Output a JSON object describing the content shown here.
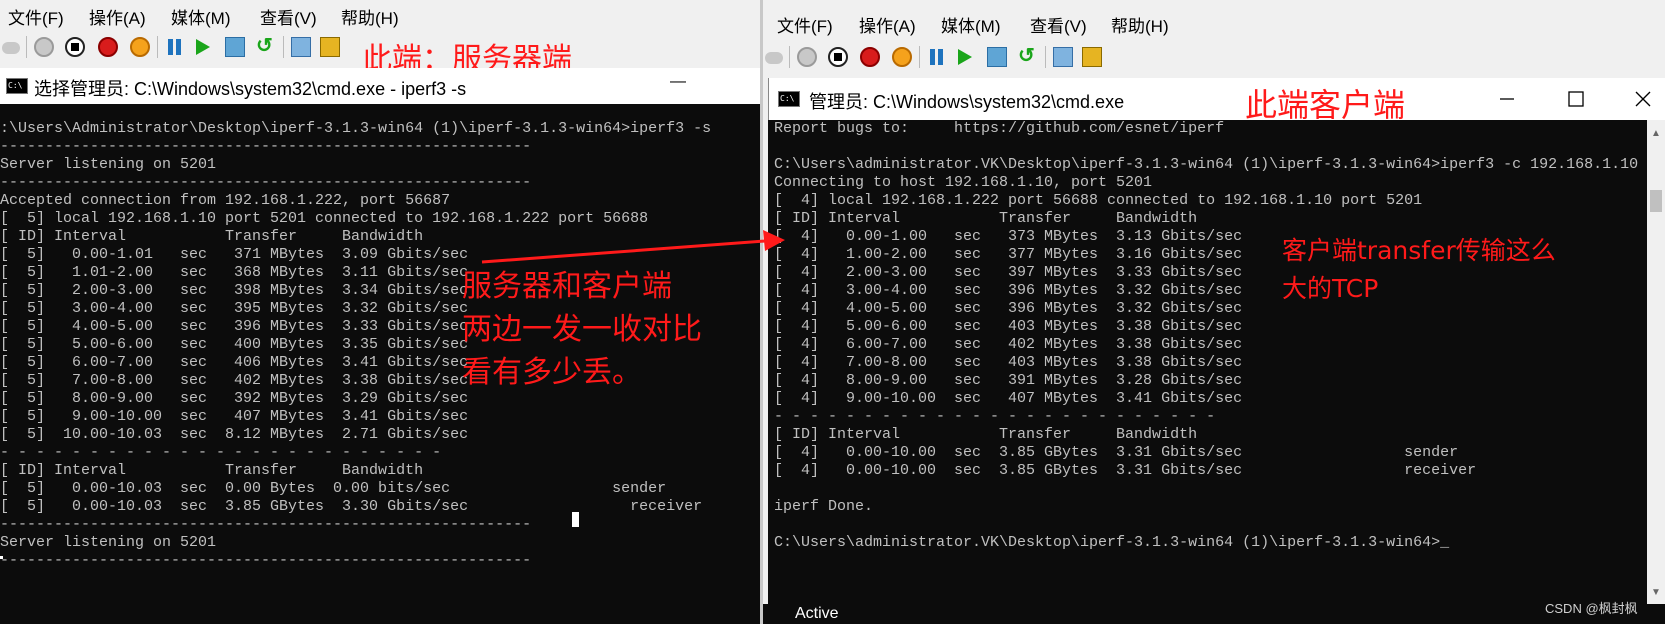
{
  "left": {
    "menu": [
      "文件(F)",
      "操作(A)",
      "媒体(M)",
      "查看(V)",
      "帮助(H)"
    ],
    "window_title": "选择管理员: C:\\Windows\\system32\\cmd.exe - iperf3  -s",
    "minimize_glyph": "—",
    "annotation_role": "此端：服务器端",
    "annotation_compare": [
      "服务器和客户端",
      "两边一发一收对比",
      "看有多少丢。"
    ],
    "console_lines": [
      ":\\Users\\Administrator\\Desktop\\iperf-3.1.3-win64 (1)\\iperf-3.1.3-win64>iperf3 -s",
      "-----------------------------------------------------------",
      "Server listening on 5201",
      "-----------------------------------------------------------",
      "Accepted connection from 192.168.1.222, port 56687",
      "[  5] local 192.168.1.10 port 5201 connected to 192.168.1.222 port 56688",
      "[ ID] Interval           Transfer     Bandwidth",
      "[  5]   0.00-1.01   sec   371 MBytes  3.09 Gbits/sec",
      "[  5]   1.01-2.00   sec   368 MBytes  3.11 Gbits/sec",
      "[  5]   2.00-3.00   sec   398 MBytes  3.34 Gbits/sec",
      "[  5]   3.00-4.00   sec   395 MBytes  3.32 Gbits/sec",
      "[  5]   4.00-5.00   sec   396 MBytes  3.33 Gbits/sec",
      "[  5]   5.00-6.00   sec   400 MBytes  3.35 Gbits/sec",
      "[  5]   6.00-7.00   sec   406 MBytes  3.41 Gbits/sec",
      "[  5]   7.00-8.00   sec   402 MBytes  3.38 Gbits/sec",
      "[  5]   8.00-9.00   sec   392 MBytes  3.29 Gbits/sec",
      "[  5]   9.00-10.00  sec   407 MBytes  3.41 Gbits/sec",
      "[  5]  10.00-10.03  sec  8.12 MBytes  2.71 Gbits/sec",
      "- - - - - - - - - - - - - - - - - - - - - - - - -",
      "[ ID] Interval           Transfer     Bandwidth",
      "[  5]   0.00-10.03  sec  0.00 Bytes  0.00 bits/sec                  sender",
      "[  5]   0.00-10.03  sec  3.85 GBytes  3.30 Gbits/sec                  receiver",
      "-----------------------------------------------------------",
      "Server listening on 5201",
      "-----------------------------------------------------------"
    ]
  },
  "right": {
    "menu": [
      "文件(F)",
      "操作(A)",
      "媒体(M)",
      "查看(V)",
      "帮助(H)"
    ],
    "window_title": "管理员: C:\\Windows\\system32\\cmd.exe",
    "annotation_role": "此端客户端",
    "annotation_transfer": [
      "客户端transfer传输这么",
      "大的TCP"
    ],
    "console_lines": [
      "Report bugs to:     https://github.com/esnet/iperf",
      "",
      "C:\\Users\\administrator.VK\\Desktop\\iperf-3.1.3-win64 (1)\\iperf-3.1.3-win64>iperf3 -c 192.168.1.10",
      "Connecting to host 192.168.1.10, port 5201",
      "[  4] local 192.168.1.222 port 56688 connected to 192.168.1.10 port 5201",
      "[ ID] Interval           Transfer     Bandwidth",
      "[  4]   0.00-1.00   sec   373 MBytes  3.13 Gbits/sec",
      "[  4]   1.00-2.00   sec   377 MBytes  3.16 Gbits/sec",
      "[  4]   2.00-3.00   sec   397 MBytes  3.33 Gbits/sec",
      "[  4]   3.00-4.00   sec   396 MBytes  3.32 Gbits/sec",
      "[  4]   4.00-5.00   sec   396 MBytes  3.32 Gbits/sec",
      "[  4]   5.00-6.00   sec   403 MBytes  3.38 Gbits/sec",
      "[  4]   6.00-7.00   sec   402 MBytes  3.38 Gbits/sec",
      "[  4]   7.00-8.00   sec   403 MBytes  3.38 Gbits/sec",
      "[  4]   8.00-9.00   sec   391 MBytes  3.28 Gbits/sec",
      "[  4]   9.00-10.00  sec   407 MBytes  3.41 Gbits/sec",
      "- - - - - - - - - - - - - - - - - - - - - - - - -",
      "[ ID] Interval           Transfer     Bandwidth",
      "[  4]   0.00-10.00  sec  3.85 GBytes  3.31 Gbits/sec                  sender",
      "[  4]   0.00-10.00  sec  3.85 GBytes  3.31 Gbits/sec                  receiver",
      "",
      "iperf Done.",
      "",
      "C:\\Users\\administrator.VK\\Desktop\\iperf-3.1.3-win64 (1)\\iperf-3.1.3-win64>_"
    ],
    "activate_text": "Active"
  },
  "watermark": "CSDN @枫封枫",
  "colors": {
    "annotation": "#ff1a1a",
    "console_bg": "#0c0c0c",
    "console_fg": "#c0c0c0"
  }
}
